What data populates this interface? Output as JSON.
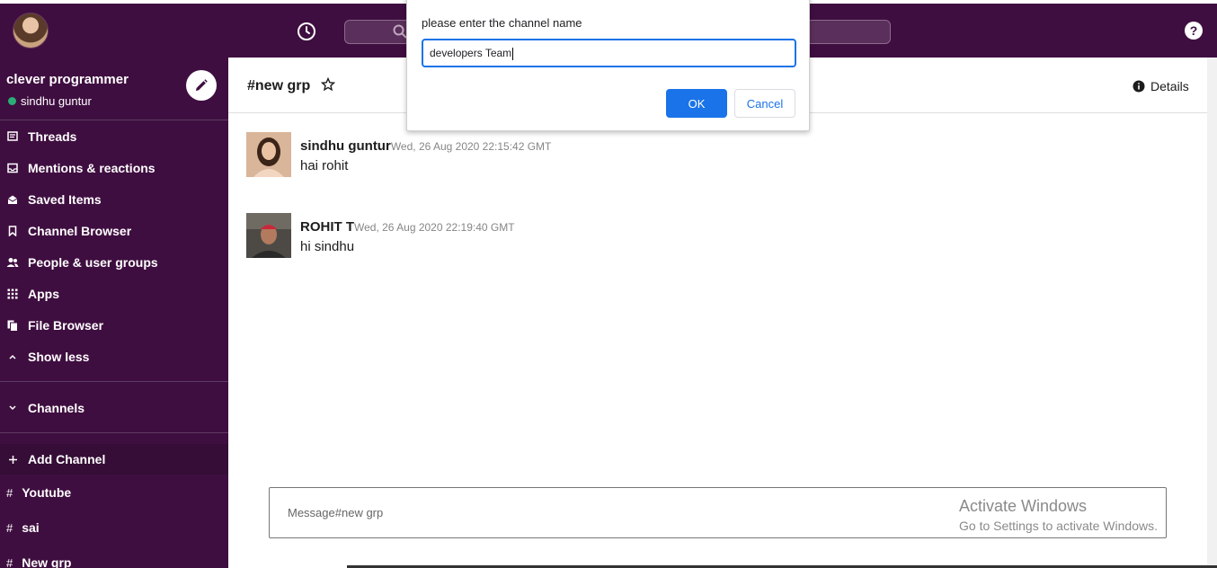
{
  "header": {
    "search_placeholder": ""
  },
  "workspace": {
    "name": "clever programmer",
    "user": "sindhu guntur"
  },
  "sidebar": {
    "items": [
      {
        "label": "Threads",
        "icon": "threads-icon"
      },
      {
        "label": "Mentions & reactions",
        "icon": "mentions-icon"
      },
      {
        "label": "Saved Items",
        "icon": "saved-icon"
      },
      {
        "label": "Channel Browser",
        "icon": "bookmark-icon"
      },
      {
        "label": "People & user groups",
        "icon": "people-icon"
      },
      {
        "label": "Apps",
        "icon": "apps-icon"
      },
      {
        "label": "File Browser",
        "icon": "file-icon"
      },
      {
        "label": "Show less",
        "icon": "chevron-up-icon"
      }
    ],
    "channels_label": "Channels",
    "add_channel_label": "Add Channel",
    "channels": [
      "Youtube",
      "sai",
      "New grp"
    ]
  },
  "channel": {
    "title": "#new grp",
    "details_label": "Details"
  },
  "messages": [
    {
      "author": "sindhu guntur",
      "time": "Wed, 26 Aug 2020 22:15:42 GMT",
      "text": "hai rohit"
    },
    {
      "author": "ROHIT T",
      "time": "Wed, 26 Aug 2020 22:19:40 GMT",
      "text": "hi sindhu"
    }
  ],
  "composer": {
    "placeholder": "Message#new grp"
  },
  "watermark": {
    "title": "Activate Windows",
    "subtitle": "Go to Settings to activate Windows."
  },
  "dialog": {
    "message": "please enter the channel name",
    "input_value": "developers Team",
    "ok_label": "OK",
    "cancel_label": "Cancel"
  },
  "colors": {
    "sidebar": "#3f0e40",
    "accent": "#1a73e8",
    "online": "#2bac76"
  }
}
